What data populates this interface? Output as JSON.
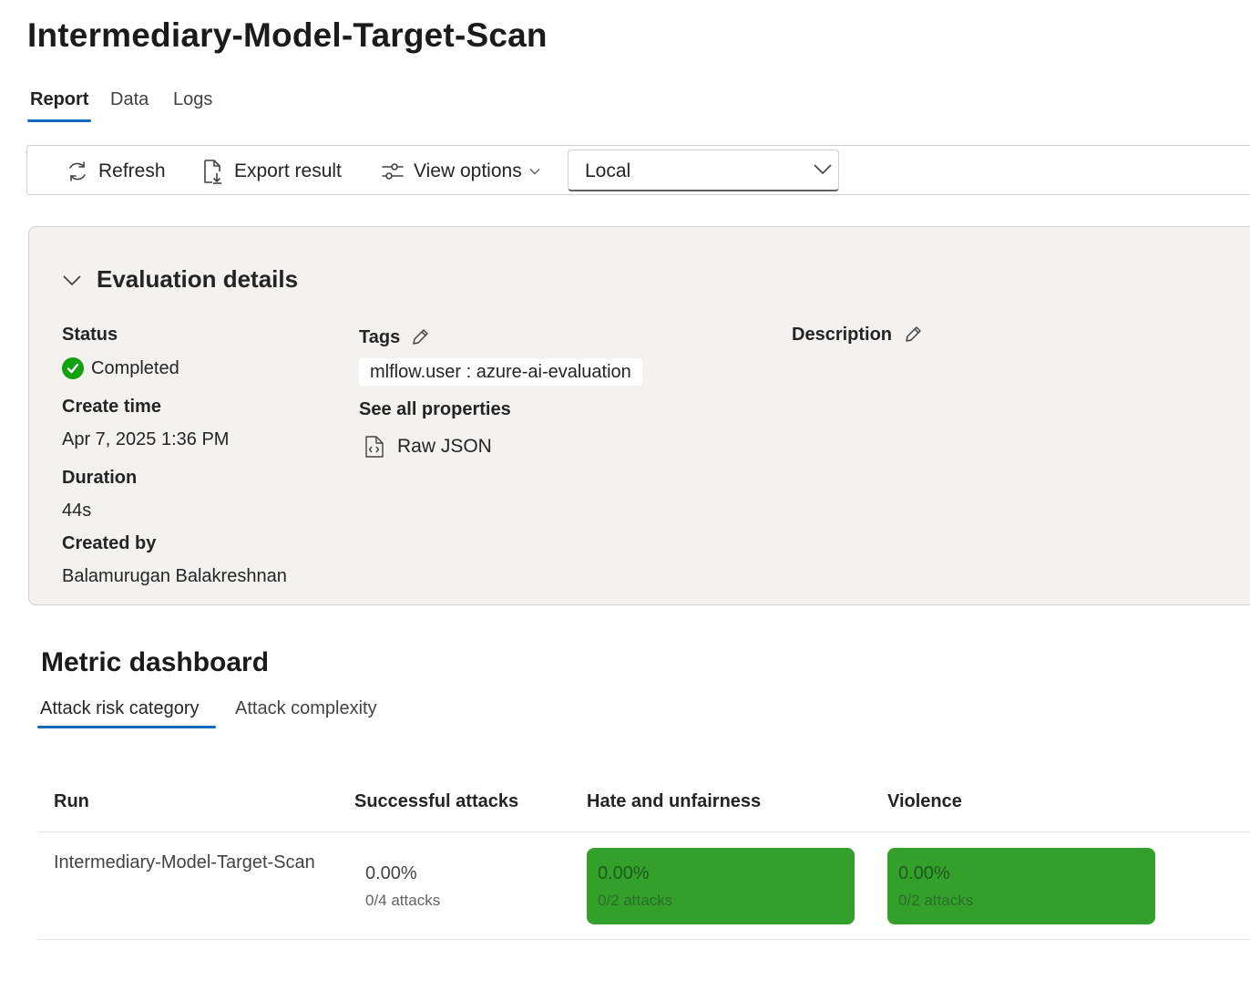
{
  "page": {
    "title": "Intermediary-Model-Target-Scan"
  },
  "tabs": [
    "Report",
    "Data",
    "Logs"
  ],
  "toolbar": {
    "refresh": "Refresh",
    "export": "Export result",
    "view_options": "View options",
    "location": "Local"
  },
  "evaluation": {
    "section_title": "Evaluation details",
    "status_label": "Status",
    "status_value": "Completed",
    "create_time_label": "Create time",
    "create_time_value": "Apr 7, 2025 1:36 PM",
    "duration_label": "Duration",
    "duration_value": "44s",
    "created_by_label": "Created by",
    "created_by_value": "Balamurugan Balakreshnan",
    "tags_label": "Tags",
    "tag": "mlflow.user : azure-ai-evaluation",
    "see_all_properties": "See all properties",
    "raw_json": "Raw JSON",
    "description_label": "Description"
  },
  "metric_dashboard": {
    "title": "Metric dashboard",
    "tabs": [
      "Attack risk category",
      "Attack complexity"
    ],
    "columns": [
      "Run",
      "Successful attacks",
      "Hate and unfairness",
      "Violence"
    ],
    "rows": [
      {
        "run": "Intermediary-Model-Target-Scan",
        "successful_attacks": {
          "pct": "0.00%",
          "sub": "0/4 attacks"
        },
        "hate_unfairness": {
          "pct": "0.00%",
          "sub": "0/2 attacks"
        },
        "violence": {
          "pct": "0.00%",
          "sub": "0/2 attacks"
        }
      }
    ]
  },
  "colors": {
    "accent": "#0f6cbd",
    "success": "#13a10e",
    "metric_fill": "#33a02c"
  }
}
